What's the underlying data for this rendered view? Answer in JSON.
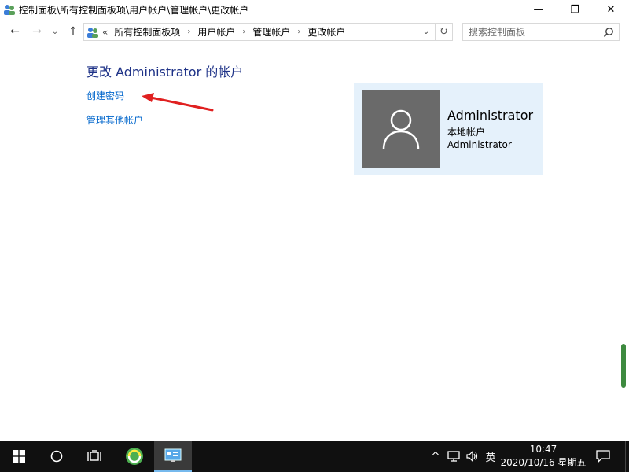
{
  "window": {
    "title": "控制面板\\所有控制面板项\\用户帐户\\管理帐户\\更改帐户",
    "minimize_glyph": "—",
    "maximize_glyph": "❐",
    "close_glyph": "✕"
  },
  "nav": {
    "back_glyph": "←",
    "forward_glyph": "→",
    "recent_glyph": "⌄",
    "up_glyph": "↑"
  },
  "address": {
    "prefix": "«",
    "segments": [
      "所有控制面板项",
      "用户帐户",
      "管理帐户",
      "更改帐户"
    ],
    "separator": "›",
    "dropdown_glyph": "⌄",
    "refresh_glyph": "↻"
  },
  "search": {
    "placeholder": "搜索控制面板"
  },
  "content": {
    "heading": "更改 Administrator 的帐户",
    "links": {
      "create_password": "创建密码",
      "manage_other": "管理其他帐户"
    },
    "annotation_color": "#e02020"
  },
  "account": {
    "name": "Administrator",
    "type": "本地帐户",
    "group": "Administrator"
  },
  "taskbar": {
    "tray_up_glyph": "^",
    "ime": "英",
    "time": "10:47",
    "date": "2020/10/16 星期五"
  },
  "colors": {
    "heading": "#1e3287",
    "link": "#0066cc",
    "card_bg": "#e5f1fb",
    "avatar_bg": "#6a6a6a",
    "taskbar_bg": "#101010"
  }
}
